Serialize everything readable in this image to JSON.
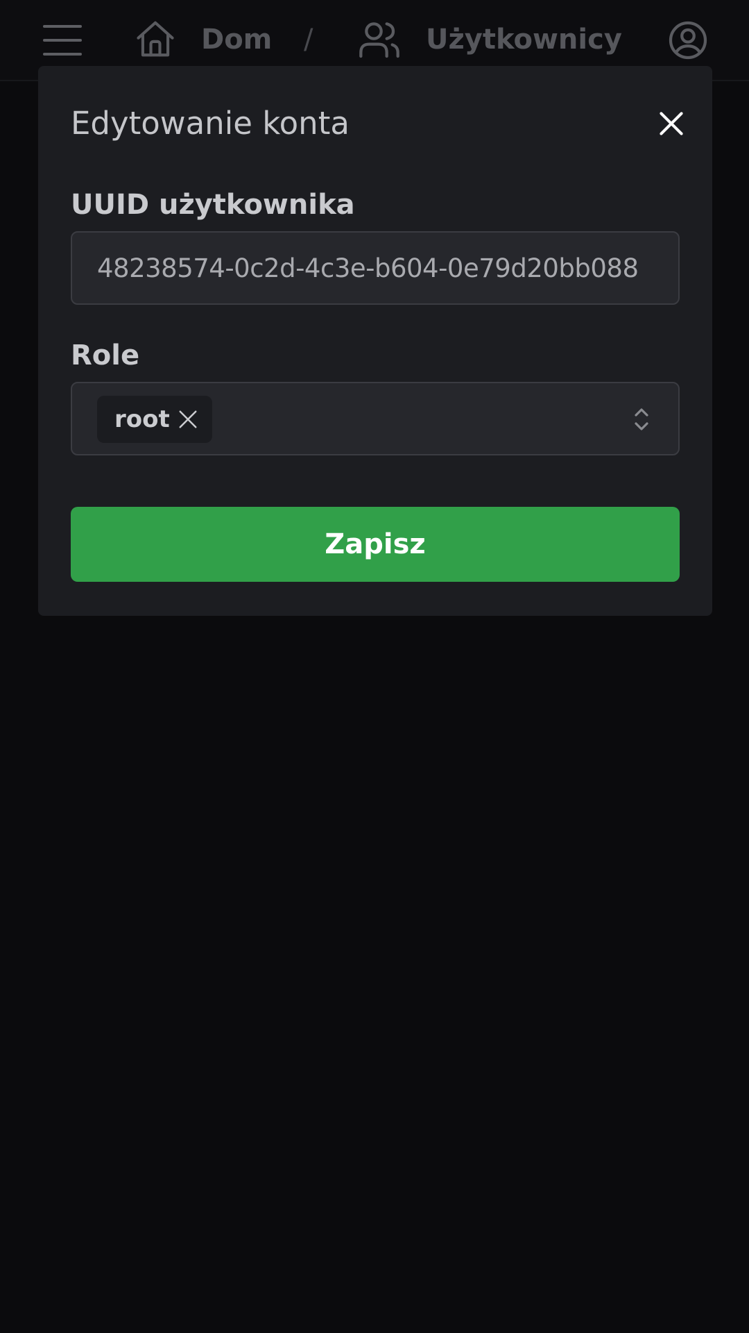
{
  "header": {
    "breadcrumb": {
      "home_label": "Dom",
      "separator": "/",
      "users_label": "Użytkownicy"
    },
    "icons": [
      "menu-icon",
      "home-icon",
      "users-icon",
      "account-icon"
    ]
  },
  "modal": {
    "title": "Edytowanie konta",
    "uuid_label": "UUID użytkownika",
    "uuid_value": "48238574-0c2d-4c3e-b604-0e79d20bb088",
    "roles_label": "Role",
    "roles": [
      {
        "label": "root"
      }
    ],
    "save_label": "Zapisz"
  },
  "colors": {
    "background": "#0b0b0d",
    "modal": "#1c1d21",
    "input": "#26272c",
    "accent": "#31a049"
  }
}
